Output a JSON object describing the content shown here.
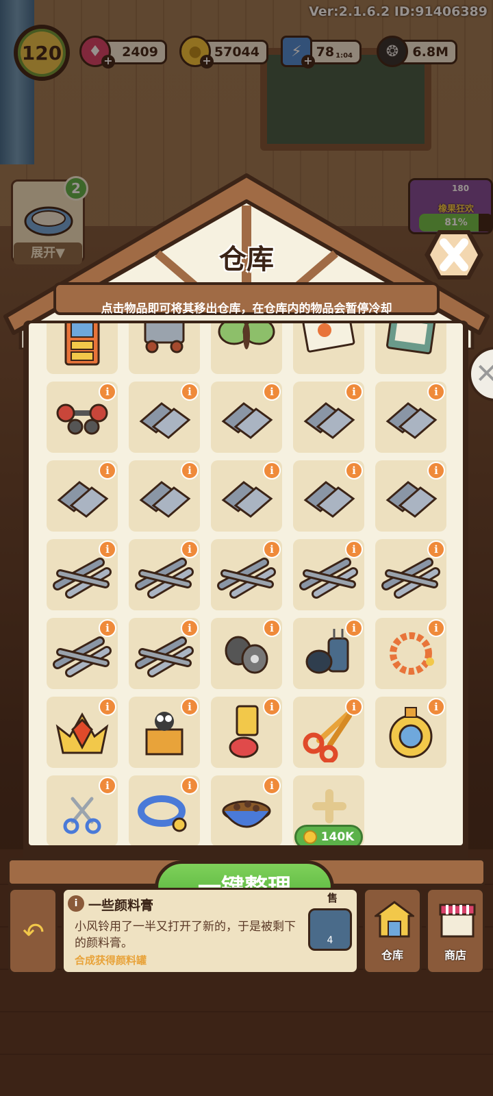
{
  "hud": {
    "version": "Ver:2.1.6.2 ID:91406389",
    "level": "120",
    "gems": "2409",
    "coins": "57044",
    "energy": "78",
    "energy_timer": "1:04",
    "seeds": "6.8M",
    "quest_count": "2",
    "expand_label": "展开▼",
    "event_name": "橡果狂欢",
    "event_count": "180",
    "event_progress_label": "81%",
    "event_progress": 0.81
  },
  "warehouse": {
    "title": "仓库",
    "hint": "点击物品即可将其移出仓库，在仓库内的物品会暂停冷却",
    "items": [
      {
        "icon": "dresser-icon",
        "info": false
      },
      {
        "icon": "cart-icon",
        "info": false
      },
      {
        "icon": "moth-icon",
        "info": false
      },
      {
        "icon": "photo-icon",
        "info": false
      },
      {
        "icon": "book-icon",
        "info": false
      },
      {
        "icon": "dumbbell-icon",
        "info": true
      },
      {
        "icon": "metal-plates-icon",
        "info": true
      },
      {
        "icon": "metal-plates-icon",
        "info": true
      },
      {
        "icon": "metal-plates-icon",
        "info": true
      },
      {
        "icon": "metal-plates-icon",
        "info": true
      },
      {
        "icon": "metal-plates-icon",
        "info": true
      },
      {
        "icon": "metal-plates-icon",
        "info": true
      },
      {
        "icon": "metal-plates-icon",
        "info": true
      },
      {
        "icon": "metal-plates-icon",
        "info": true
      },
      {
        "icon": "metal-plates-icon",
        "info": true
      },
      {
        "icon": "metal-rods-icon",
        "info": true
      },
      {
        "icon": "metal-rods-icon",
        "info": true
      },
      {
        "icon": "metal-rods-icon",
        "info": true
      },
      {
        "icon": "metal-rods-icon",
        "info": true
      },
      {
        "icon": "metal-rods-icon",
        "info": true
      },
      {
        "icon": "metal-rods-icon",
        "info": true
      },
      {
        "icon": "metal-rods-icon",
        "info": true
      },
      {
        "icon": "wire-spool-icon",
        "info": true
      },
      {
        "icon": "capacitor-icon",
        "info": true
      },
      {
        "icon": "bead-bracelet-icon",
        "info": true
      },
      {
        "icon": "crown-icon",
        "info": true
      },
      {
        "icon": "spider-box-icon",
        "info": true
      },
      {
        "icon": "paint-tube-icon",
        "info": true
      },
      {
        "icon": "scissors-icon",
        "info": true
      },
      {
        "icon": "gold-medal-icon",
        "info": true
      },
      {
        "icon": "small-scissors-icon",
        "info": true
      },
      {
        "icon": "pet-collar-icon",
        "info": true
      },
      {
        "icon": "pet-food-bowl-icon",
        "info": true
      }
    ],
    "add_slot_price": "140K",
    "organize_button": "一键整理"
  },
  "bottom": {
    "info_title": "一些颜料膏",
    "info_desc": "小风铃用了一半又打开了新的，于是被剩下的颜料膏。",
    "info_link": "合成获得颜料罐",
    "sell_label": "售",
    "sell_value": "4",
    "warehouse_label": "仓库",
    "shop_label": "商店"
  },
  "colors": {
    "accent_green": "#5cb24a",
    "info_orange": "#ef8a3a",
    "wood": "#a06b45",
    "outline": "#3b2417",
    "panel_bg": "#f6f1e0",
    "slot_bg": "#ede0bf"
  }
}
